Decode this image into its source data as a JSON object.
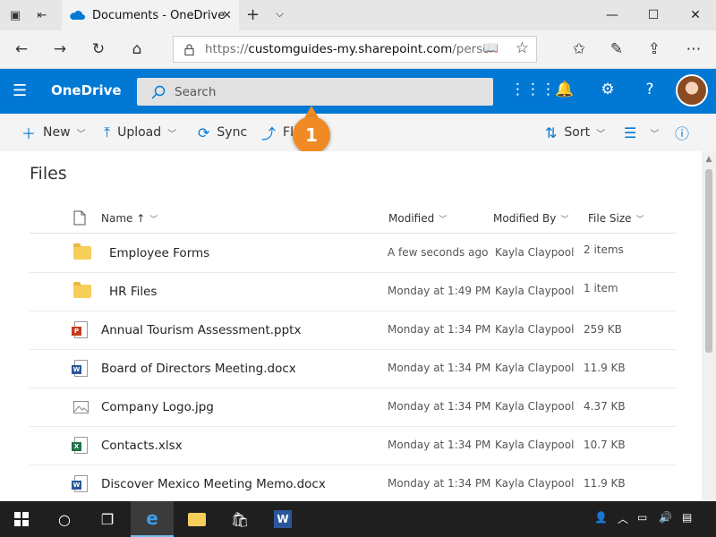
{
  "browser": {
    "tab_title": "Documents - OneDrive",
    "tab_close_glyph": "✕",
    "new_tab_glyph": "+",
    "url_prefix": "https://",
    "url_host": "customguides-my.sharepoint.com",
    "url_path": "/personal/s",
    "window_controls": [
      "—",
      "☐",
      "✕"
    ]
  },
  "suitebar": {
    "app_name": "OneDrive",
    "search_placeholder": "Search",
    "accent": "#0078d4"
  },
  "commandbar": {
    "new_label": "New",
    "upload_label": "Upload",
    "sync_label": "Sync",
    "flow_label": "Fl",
    "sort_label": "Sort"
  },
  "callout": {
    "number": "1",
    "color": "#f08a24"
  },
  "files": {
    "title": "Files",
    "columns": {
      "name": "Name",
      "sort_arrow": "↑",
      "modified": "Modified",
      "modified_by": "Modified By",
      "file_size": "File Size"
    },
    "rows": [
      {
        "name": "Employee Forms",
        "type": "folder",
        "modified": "A few seconds ago",
        "modified_by": "Kayla Claypool",
        "size": "2 items"
      },
      {
        "name": "HR Files",
        "type": "folder",
        "modified": "Monday at 1:49 PM",
        "modified_by": "Kayla Claypool",
        "size": "1 item"
      },
      {
        "name": "Annual Tourism Assessment.pptx",
        "type": "pptx",
        "modified": "Monday at 1:34 PM",
        "modified_by": "Kayla Claypool",
        "size": "259 KB"
      },
      {
        "name": "Board of Directors Meeting.docx",
        "type": "docx",
        "modified": "Monday at 1:34 PM",
        "modified_by": "Kayla Claypool",
        "size": "11.9 KB"
      },
      {
        "name": "Company Logo.jpg",
        "type": "jpg",
        "modified": "Monday at 1:34 PM",
        "modified_by": "Kayla Claypool",
        "size": "4.37 KB"
      },
      {
        "name": "Contacts.xlsx",
        "type": "xlsx",
        "modified": "Monday at 1:34 PM",
        "modified_by": "Kayla Claypool",
        "size": "10.7 KB"
      },
      {
        "name": "Discover Mexico Meeting Memo.docx",
        "type": "docx",
        "modified": "Monday at 1:34 PM",
        "modified_by": "Kayla Claypool",
        "size": "11.9 KB"
      }
    ]
  },
  "icon_colors": {
    "pptx": "#c43e1c",
    "docx": "#2b579a",
    "xlsx": "#217346"
  }
}
